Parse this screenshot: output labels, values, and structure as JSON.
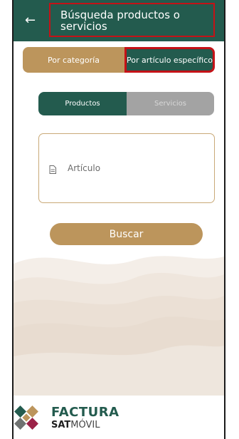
{
  "header": {
    "back_icon": "arrow-left-icon",
    "title": "Búsqueda productos o servicios"
  },
  "search_mode": {
    "options": [
      "Por categoría",
      "Por artículo específico"
    ],
    "selected": "Por artículo específico"
  },
  "type_toggle": {
    "options": [
      "Productos",
      "Servicios"
    ],
    "selected": "Productos"
  },
  "article_input": {
    "icon": "document-icon",
    "placeholder": "Artículo"
  },
  "search_button": {
    "label": "Buscar"
  },
  "footer": {
    "logo_icon": "factura-sat-logo-icon",
    "brand_line1": "FACTURA",
    "brand_line2_a": "SAT",
    "brand_line2_b": "MÓVIL"
  },
  "colors": {
    "primary_green": "#235b4e",
    "gold": "#bc955c",
    "highlight_red": "#c41217",
    "inactive_gray": "#a3a3a3"
  }
}
